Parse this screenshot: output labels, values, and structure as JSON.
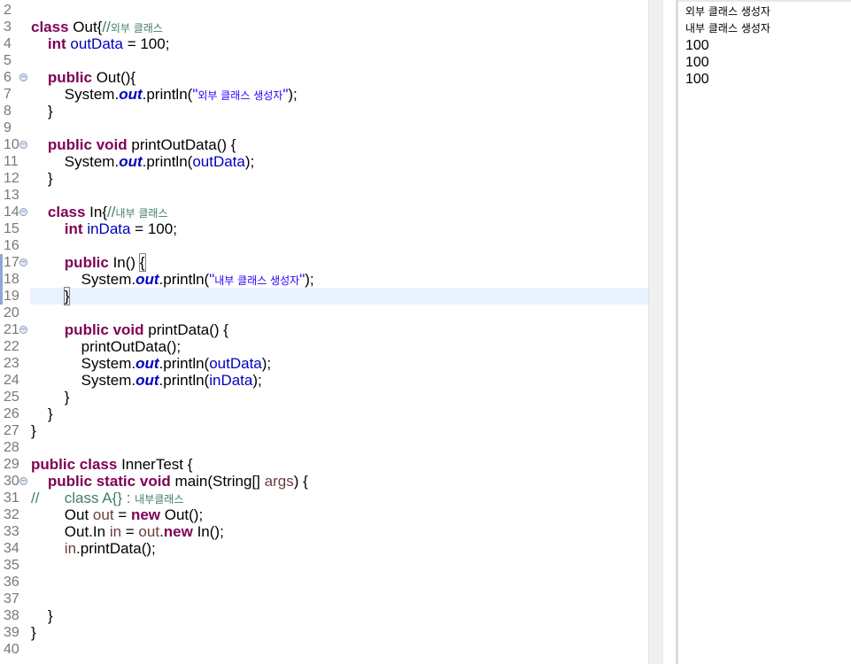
{
  "editor": {
    "lines": [
      {
        "n": "2",
        "tokens": []
      },
      {
        "n": "3",
        "tokens": [
          {
            "t": "class",
            "c": "kw"
          },
          {
            "t": " Out{",
            "c": ""
          },
          {
            "t": "//",
            "c": "cmt"
          },
          {
            "t": "외부 클래스",
            "c": "cmt ko"
          }
        ]
      },
      {
        "n": "4",
        "tokens": [
          {
            "t": "    ",
            "c": ""
          },
          {
            "t": "int",
            "c": "kw"
          },
          {
            "t": " ",
            "c": ""
          },
          {
            "t": "outData",
            "c": "fld"
          },
          {
            "t": " = 100;",
            "c": ""
          }
        ]
      },
      {
        "n": "5",
        "tokens": []
      },
      {
        "n": "6",
        "fold": true,
        "tokens": [
          {
            "t": "    ",
            "c": ""
          },
          {
            "t": "public",
            "c": "kw"
          },
          {
            "t": " Out(){",
            "c": ""
          }
        ]
      },
      {
        "n": "7",
        "tokens": [
          {
            "t": "        System.",
            "c": ""
          },
          {
            "t": "out",
            "c": "sfld"
          },
          {
            "t": ".println(",
            "c": ""
          },
          {
            "t": "\"",
            "c": "str"
          },
          {
            "t": "외부 클래스 생성자",
            "c": "str ko"
          },
          {
            "t": "\"",
            "c": "str"
          },
          {
            "t": ");",
            "c": ""
          }
        ]
      },
      {
        "n": "8",
        "tokens": [
          {
            "t": "    }",
            "c": ""
          }
        ]
      },
      {
        "n": "9",
        "tokens": []
      },
      {
        "n": "10",
        "fold": true,
        "tokens": [
          {
            "t": "    ",
            "c": ""
          },
          {
            "t": "public",
            "c": "kw"
          },
          {
            "t": " ",
            "c": ""
          },
          {
            "t": "void",
            "c": "kw"
          },
          {
            "t": " printOutData() {",
            "c": ""
          }
        ]
      },
      {
        "n": "11",
        "tokens": [
          {
            "t": "        System.",
            "c": ""
          },
          {
            "t": "out",
            "c": "sfld"
          },
          {
            "t": ".println(",
            "c": ""
          },
          {
            "t": "outData",
            "c": "fld"
          },
          {
            "t": ");",
            "c": ""
          }
        ]
      },
      {
        "n": "12",
        "tokens": [
          {
            "t": "    }",
            "c": ""
          }
        ]
      },
      {
        "n": "13",
        "tokens": []
      },
      {
        "n": "14",
        "fold": true,
        "tokens": [
          {
            "t": "    ",
            "c": ""
          },
          {
            "t": "class",
            "c": "kw"
          },
          {
            "t": " In{",
            "c": ""
          },
          {
            "t": "//",
            "c": "cmt"
          },
          {
            "t": "내부 클래스",
            "c": "cmt ko"
          }
        ]
      },
      {
        "n": "15",
        "tokens": [
          {
            "t": "        ",
            "c": ""
          },
          {
            "t": "int",
            "c": "kw"
          },
          {
            "t": " ",
            "c": ""
          },
          {
            "t": "inData",
            "c": "fld"
          },
          {
            "t": " = 100;",
            "c": ""
          }
        ]
      },
      {
        "n": "16",
        "tokens": []
      },
      {
        "n": "17",
        "fold": true,
        "tokens": [
          {
            "t": "        ",
            "c": ""
          },
          {
            "t": "public",
            "c": "kw"
          },
          {
            "t": " In() ",
            "c": ""
          },
          {
            "t": "{",
            "c": "brace-box"
          }
        ]
      },
      {
        "n": "18",
        "tokens": [
          {
            "t": "            System.",
            "c": ""
          },
          {
            "t": "out",
            "c": "sfld"
          },
          {
            "t": ".println(",
            "c": ""
          },
          {
            "t": "\"",
            "c": "str"
          },
          {
            "t": "내부 클래스 생성자",
            "c": "str ko"
          },
          {
            "t": "\"",
            "c": "str"
          },
          {
            "t": ");",
            "c": ""
          }
        ]
      },
      {
        "n": "19",
        "current": true,
        "caret": true,
        "tokens": [
          {
            "t": "        ",
            "c": ""
          },
          {
            "t": "}",
            "c": "brace-box"
          }
        ]
      },
      {
        "n": "20",
        "tokens": []
      },
      {
        "n": "21",
        "fold": true,
        "tokens": [
          {
            "t": "        ",
            "c": ""
          },
          {
            "t": "public",
            "c": "kw"
          },
          {
            "t": " ",
            "c": ""
          },
          {
            "t": "void",
            "c": "kw"
          },
          {
            "t": " printData() {",
            "c": ""
          }
        ]
      },
      {
        "n": "22",
        "tokens": [
          {
            "t": "            printOutData();",
            "c": ""
          }
        ]
      },
      {
        "n": "23",
        "tokens": [
          {
            "t": "            System.",
            "c": ""
          },
          {
            "t": "out",
            "c": "sfld"
          },
          {
            "t": ".println(",
            "c": ""
          },
          {
            "t": "outData",
            "c": "fld"
          },
          {
            "t": ");",
            "c": ""
          }
        ]
      },
      {
        "n": "24",
        "tokens": [
          {
            "t": "            System.",
            "c": ""
          },
          {
            "t": "out",
            "c": "sfld"
          },
          {
            "t": ".println(",
            "c": ""
          },
          {
            "t": "inData",
            "c": "fld"
          },
          {
            "t": ");",
            "c": ""
          }
        ]
      },
      {
        "n": "25",
        "tokens": [
          {
            "t": "        }",
            "c": ""
          }
        ]
      },
      {
        "n": "26",
        "tokens": [
          {
            "t": "    }",
            "c": ""
          }
        ]
      },
      {
        "n": "27",
        "tokens": [
          {
            "t": "}",
            "c": ""
          }
        ]
      },
      {
        "n": "28",
        "tokens": []
      },
      {
        "n": "29",
        "tokens": [
          {
            "t": "public",
            "c": "kw"
          },
          {
            "t": " ",
            "c": ""
          },
          {
            "t": "class",
            "c": "kw"
          },
          {
            "t": " InnerTest {",
            "c": ""
          }
        ]
      },
      {
        "n": "30",
        "fold": true,
        "tokens": [
          {
            "t": "    ",
            "c": ""
          },
          {
            "t": "public",
            "c": "kw"
          },
          {
            "t": " ",
            "c": ""
          },
          {
            "t": "static",
            "c": "kw"
          },
          {
            "t": " ",
            "c": ""
          },
          {
            "t": "void",
            "c": "kw"
          },
          {
            "t": " main(String[] ",
            "c": ""
          },
          {
            "t": "args",
            "c": "var"
          },
          {
            "t": ") {",
            "c": ""
          }
        ]
      },
      {
        "n": "31",
        "tokens": [
          {
            "t": "//      class A{} : ",
            "c": "cmt"
          },
          {
            "t": "내부클래스",
            "c": "cmt ko"
          }
        ]
      },
      {
        "n": "32",
        "tokens": [
          {
            "t": "        Out ",
            "c": ""
          },
          {
            "t": "out",
            "c": "var"
          },
          {
            "t": " = ",
            "c": ""
          },
          {
            "t": "new",
            "c": "kw"
          },
          {
            "t": " Out();",
            "c": ""
          }
        ]
      },
      {
        "n": "33",
        "tokens": [
          {
            "t": "        Out.In ",
            "c": ""
          },
          {
            "t": "in",
            "c": "var"
          },
          {
            "t": " = ",
            "c": ""
          },
          {
            "t": "out",
            "c": "var"
          },
          {
            "t": ".",
            "c": ""
          },
          {
            "t": "new",
            "c": "kw"
          },
          {
            "t": " In();",
            "c": ""
          }
        ]
      },
      {
        "n": "34",
        "tokens": [
          {
            "t": "        ",
            "c": ""
          },
          {
            "t": "in",
            "c": "var"
          },
          {
            "t": ".printData();",
            "c": ""
          }
        ]
      },
      {
        "n": "35",
        "tokens": []
      },
      {
        "n": "36",
        "tokens": []
      },
      {
        "n": "37",
        "tokens": []
      },
      {
        "n": "38",
        "tokens": [
          {
            "t": "    }",
            "c": ""
          }
        ]
      },
      {
        "n": "39",
        "tokens": [
          {
            "t": "}",
            "c": ""
          }
        ]
      },
      {
        "n": "40",
        "tokens": []
      }
    ]
  },
  "console": {
    "lines": [
      {
        "text": "외부 클래스 생성자",
        "kind": "ko"
      },
      {
        "text": "내부 클래스 생성자",
        "kind": "ko"
      },
      {
        "text": "100",
        "kind": "num"
      },
      {
        "text": "100",
        "kind": "num"
      },
      {
        "text": "100",
        "kind": "num"
      }
    ]
  },
  "colors": {
    "keyword": "#7f0055",
    "field": "#0000c0",
    "string": "#2a00ff",
    "comment": "#3f7f5f",
    "local_var": "#6a3e3e",
    "current_line": "#e8f2fe"
  }
}
